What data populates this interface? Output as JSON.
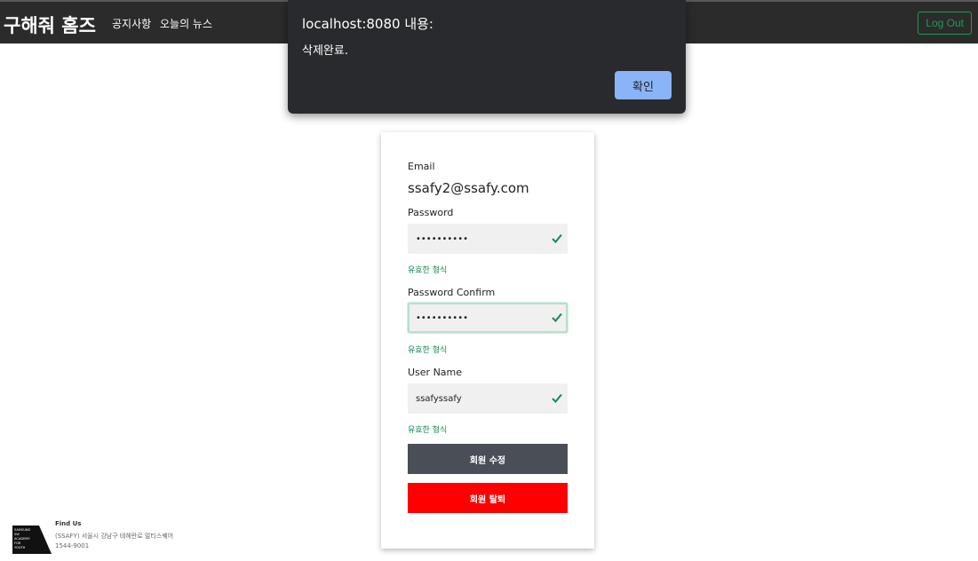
{
  "navbar": {
    "brand": "구해줘 홈즈",
    "links": [
      "공지사항",
      "오늘의 뉴스"
    ],
    "logout_label": "Log Out"
  },
  "alert": {
    "title": "localhost:8080 내용:",
    "message": "삭제완료.",
    "ok_label": "확인"
  },
  "form": {
    "email_label": "Email",
    "email_value": "ssafy2@ssafy.com",
    "password_label": "Password",
    "password_value": "••••••••••",
    "password_valid": "유효한 형식",
    "confirm_label": "Password Confirm",
    "confirm_value": "••••••••••",
    "confirm_valid": "유효한 형식",
    "username_label": "User Name",
    "username_value": "ssafyssafy",
    "username_valid": "유효한 형식",
    "edit_label": "회원 수정",
    "delete_label": "회원 탈퇴"
  },
  "footer": {
    "logo_text": "SAMSUNG SW ACADEMY FOR YOUTH",
    "title": "Find Us",
    "address": "(SSAFY) 서울시 강남구 테헤란로 멀티스퀘어",
    "phone": "1544-9001"
  },
  "colors": {
    "navbar_bg": "#2b2b2b",
    "valid_green": "#198754",
    "edit_button": "#4a4e57",
    "delete_button": "#ff0000",
    "alert_button": "#8ab4f8"
  },
  "icons": [
    "check-icon",
    "ssafy-logo"
  ]
}
